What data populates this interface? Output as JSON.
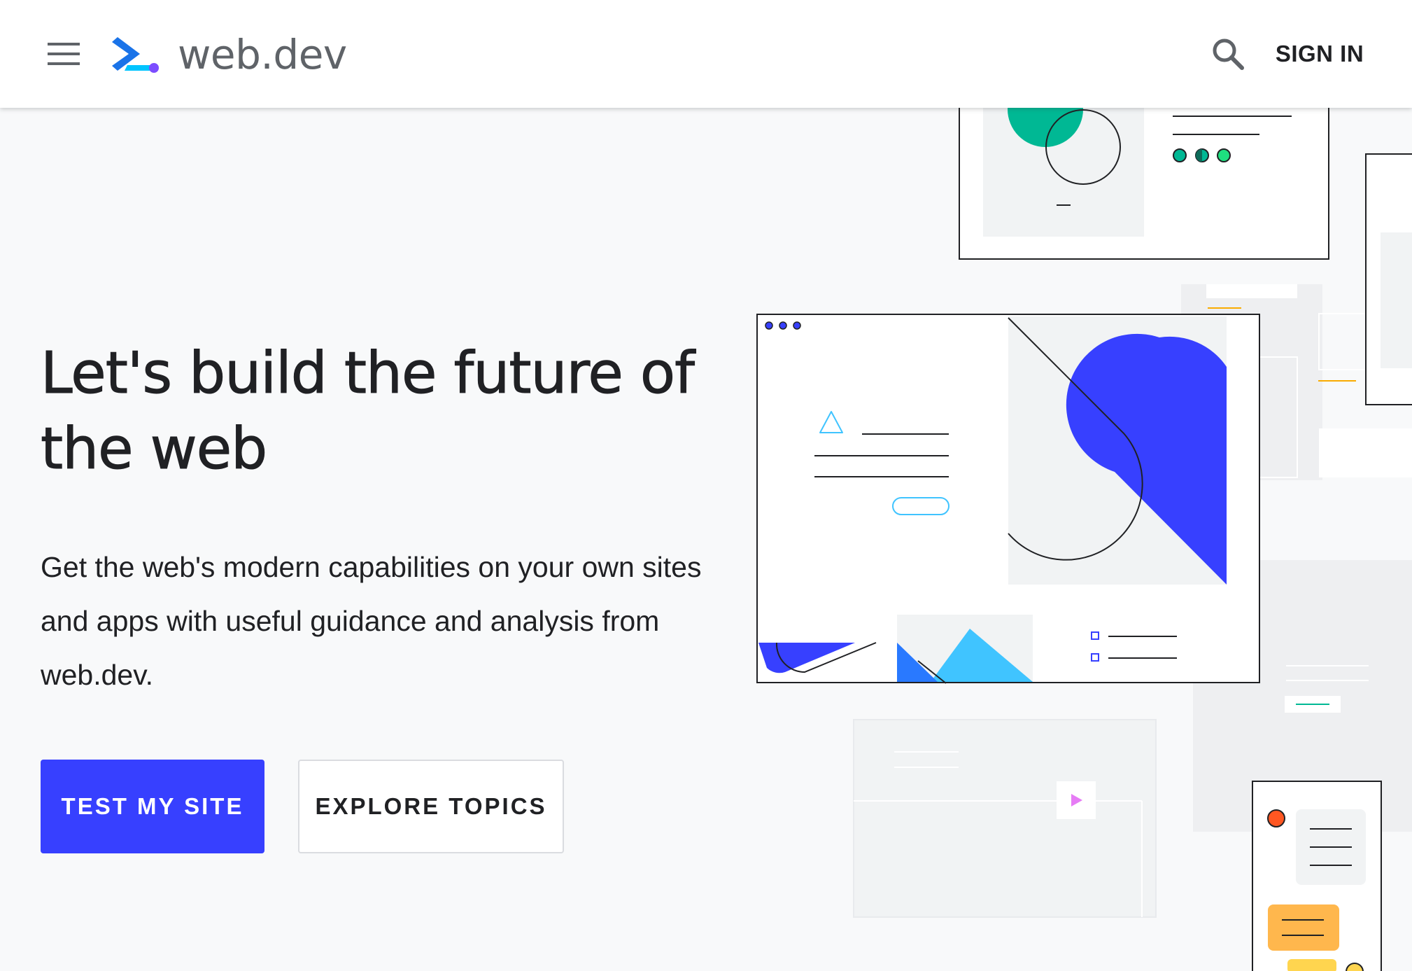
{
  "header": {
    "menu_icon": "hamburger-menu-icon",
    "logo_icon": "web-dev-logo-icon",
    "logo_text": "web.dev",
    "search_icon": "search-icon",
    "signin_label": "SIGN IN"
  },
  "hero": {
    "title": "Let's build the future of the web",
    "subtitle": "Get the web's modern capabilities on your own sites and apps with useful guidance and analysis from web.dev.",
    "primary_button": "TEST MY SITE",
    "secondary_button": "EXPLORE TOPICS"
  },
  "colors": {
    "accent": "#3740ff",
    "background": "#f8f9fa",
    "header_bg": "#ffffff",
    "text": "#202124",
    "teal": "#00b894",
    "light_blue": "#40c4ff",
    "orange": "#ff9800",
    "yellow": "#ffc845"
  }
}
